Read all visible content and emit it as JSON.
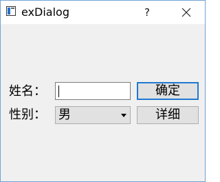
{
  "window": {
    "title": "exDialog",
    "help_label": "?",
    "accent_color": "#1f78d1"
  },
  "form": {
    "name_label": "姓名：",
    "name_value": "",
    "gender_label": "性别：",
    "gender_selected": "男"
  },
  "buttons": {
    "ok_label": "确定",
    "detail_label": "详细"
  },
  "icons": {
    "app": "app-window-icon",
    "close": "close-icon",
    "dropdown": "chevron-down-icon"
  }
}
